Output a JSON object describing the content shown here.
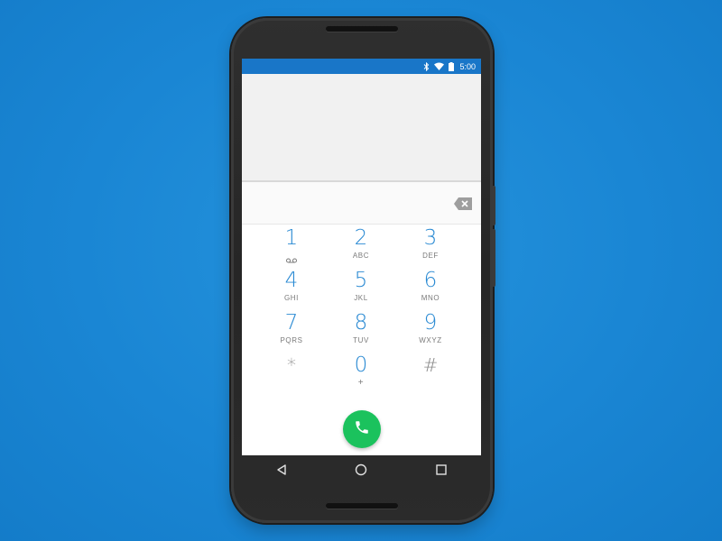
{
  "status_bar": {
    "time": "5:00",
    "icons": [
      "bluetooth-icon",
      "wifi-icon",
      "battery-icon"
    ]
  },
  "dialer": {
    "digits": "",
    "backspace_icon": "backspace-icon"
  },
  "keypad": [
    {
      "digit": "1",
      "letters": "",
      "icon": "voicemail-icon"
    },
    {
      "digit": "2",
      "letters": "ABC"
    },
    {
      "digit": "3",
      "letters": "DEF"
    },
    {
      "digit": "4",
      "letters": "GHI"
    },
    {
      "digit": "5",
      "letters": "JKL"
    },
    {
      "digit": "6",
      "letters": "MNO"
    },
    {
      "digit": "7",
      "letters": "PQRS"
    },
    {
      "digit": "8",
      "letters": "TUV"
    },
    {
      "digit": "9",
      "letters": "WXYZ"
    },
    {
      "digit": "*",
      "letters": ""
    },
    {
      "digit": "0",
      "letters": "+"
    },
    {
      "digit": "#",
      "letters": ""
    }
  ],
  "call_button": {
    "icon": "phone-icon"
  },
  "nav": [
    "back-icon",
    "home-icon",
    "recents-icon"
  ],
  "colors": {
    "background": "#1a86d4",
    "status_bar": "#1976c8",
    "digit": "#2a8ad3",
    "call": "#1bc25d",
    "phone_body": "#2b2b2b"
  }
}
